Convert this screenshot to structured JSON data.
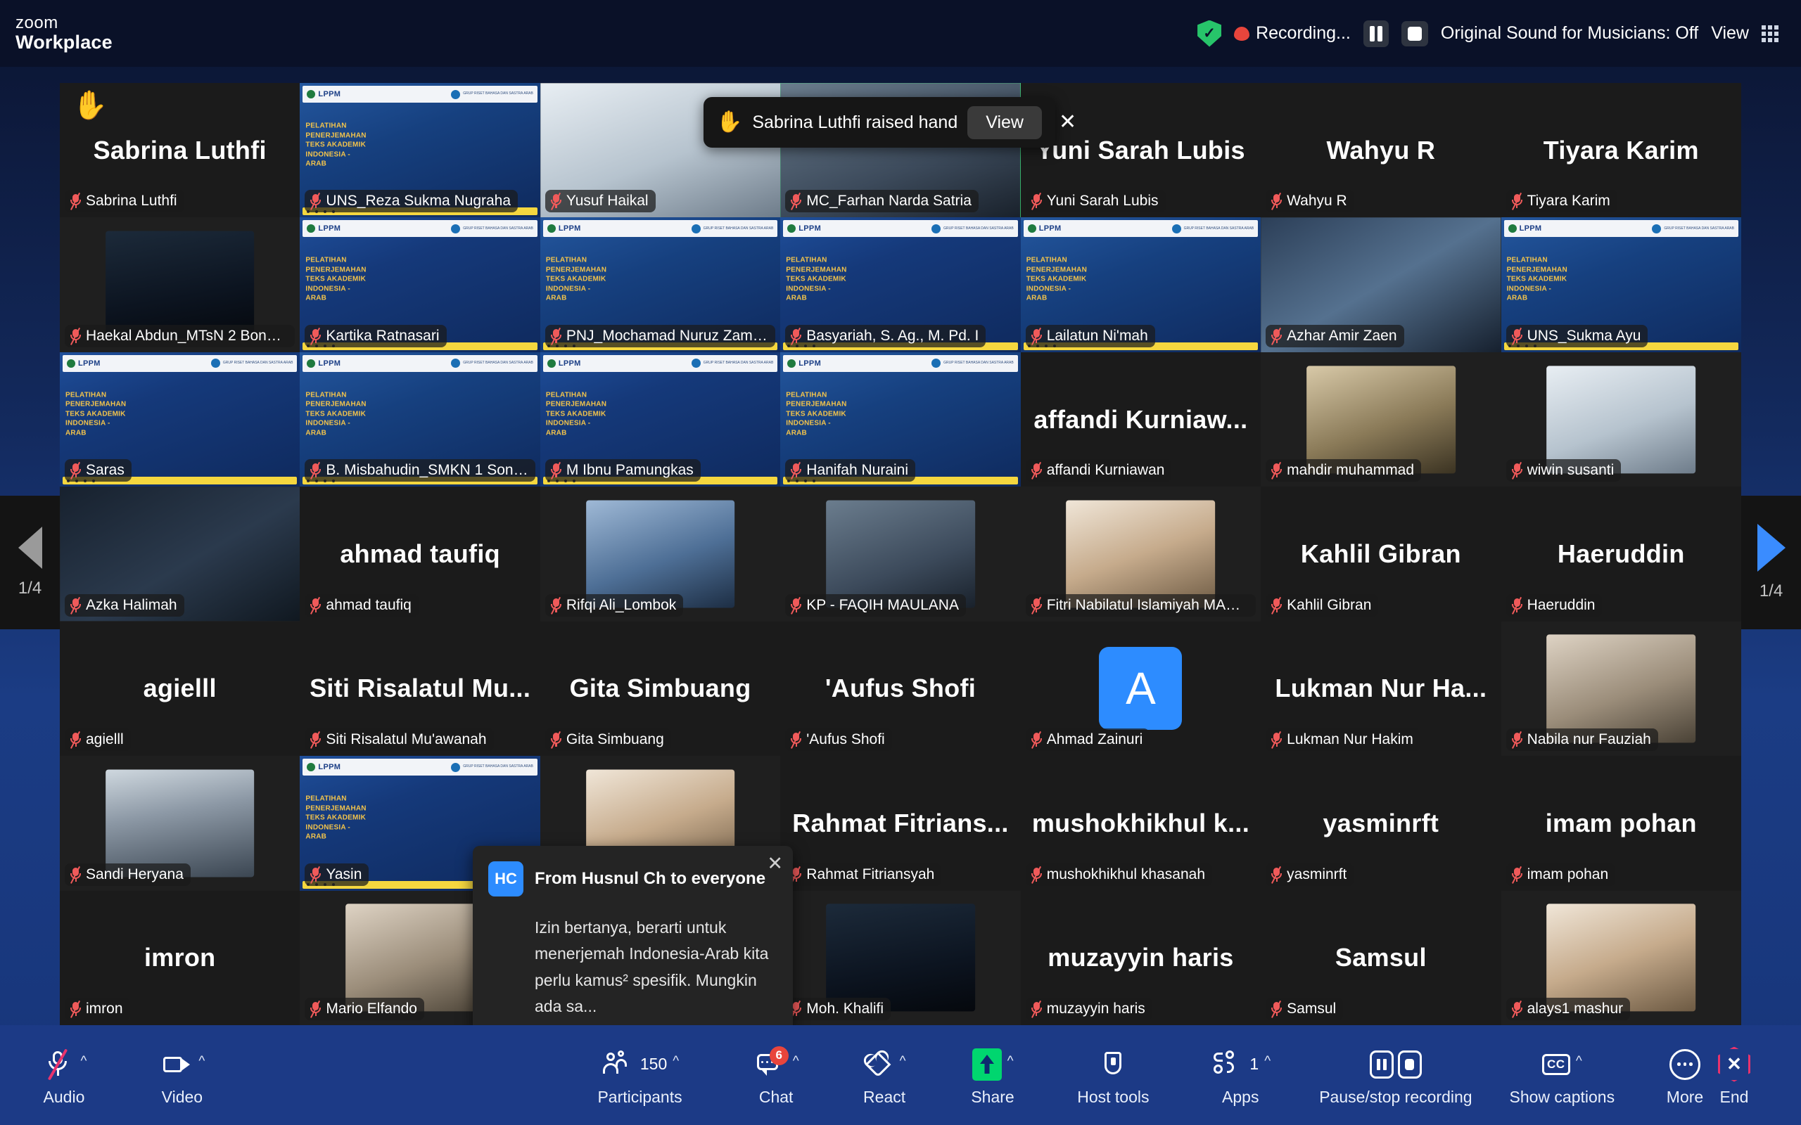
{
  "app": {
    "brand_line1": "zoom",
    "brand_line2": "Workplace"
  },
  "topbar": {
    "encryption_icon": "shield-check-icon",
    "recording_icon": "recording-dot-icon",
    "recording_text": "Recording...",
    "pause_icon": "pause-icon",
    "stop_icon": "stop-icon",
    "original_sound_label": "Original Sound for Musicians: Off",
    "view_label": "View",
    "view_grid_icon": "grid-view-icon"
  },
  "hand_toast": {
    "hand_icon": "raised-hand-icon",
    "message": "Sabrina Luthfi raised hand",
    "view_button": "View",
    "close_icon": "close-icon"
  },
  "chat_toast": {
    "avatar_initials": "HC",
    "header": "From Husnul Ch to everyone",
    "message": "Izin bertanya, berarti untuk menerjemah Indonesia-Arab kita perlu kamus² spesifik. Mungkin ada sa...",
    "close_icon": "close-icon"
  },
  "pagination": {
    "prev_icon": "chevron-left-icon",
    "next_icon": "chevron-right-icon",
    "prev_count": "1/4",
    "next_count": "1/4"
  },
  "slide": {
    "brand": "LPPM",
    "title_lines": "PELATIHAN\nPENERJEMAHAN\nTEKS AKADEMIK\nINDONESIA -\nARAB",
    "header_right": "GRUP RISET BAHASA DAN SASTRA ARAB\nFAKULTAS ILMU BUDAYA\nUNIVERSITAS SEBELAS MARET"
  },
  "participants": [
    {
      "label": "Sabrina Luthfi",
      "big": "Sabrina Luthfi",
      "kind": "name",
      "muted": true,
      "hand": true,
      "speaking": false
    },
    {
      "label": "UNS_Reza Sukma Nugraha",
      "big": "",
      "kind": "slide",
      "muted": true,
      "hand": false,
      "speaking": false
    },
    {
      "label": "Yusuf Haikal",
      "big": "",
      "kind": "video",
      "muted": true,
      "hand": false,
      "speaking": false,
      "photo": "ph-e"
    },
    {
      "label": "MC_Farhan Narda Satria",
      "big": "",
      "kind": "video",
      "muted": true,
      "hand": false,
      "speaking": true,
      "photo": "ph-c"
    },
    {
      "label": "Yuni Sarah Lubis",
      "big": "Yuni Sarah Lubis",
      "kind": "name",
      "muted": true,
      "hand": false,
      "speaking": false
    },
    {
      "label": "Wahyu R",
      "big": "Wahyu R",
      "kind": "name",
      "muted": true,
      "hand": false,
      "speaking": false
    },
    {
      "label": "Tiyara Karim",
      "big": "Tiyara Karim",
      "kind": "name",
      "muted": true,
      "hand": false,
      "speaking": false
    },
    {
      "label": "Haekal Abdun_MTsN 2 Bondo...",
      "big": "",
      "kind": "photo",
      "muted": true,
      "hand": false,
      "speaking": false,
      "photo": "ph-f"
    },
    {
      "label": "Kartika Ratnasari",
      "big": "",
      "kind": "slide",
      "muted": true,
      "hand": false,
      "speaking": false
    },
    {
      "label": "PNJ_Mochamad Nuruz Zaman",
      "big": "",
      "kind": "slide",
      "muted": true,
      "hand": false,
      "speaking": false
    },
    {
      "label": "Basyariah, S. Ag., M. Pd. I",
      "big": "",
      "kind": "slide",
      "muted": true,
      "hand": false,
      "speaking": false
    },
    {
      "label": "Lailatun Ni'mah",
      "big": "",
      "kind": "slide",
      "muted": true,
      "hand": false,
      "speaking": false
    },
    {
      "label": "Azhar Amir Zaen",
      "big": "",
      "kind": "video",
      "muted": true,
      "hand": false,
      "speaking": false,
      "photo": "ph-h"
    },
    {
      "label": "UNS_Sukma Ayu",
      "big": "",
      "kind": "slide",
      "muted": true,
      "hand": false,
      "speaking": false
    },
    {
      "label": "Saras",
      "big": "",
      "kind": "slide",
      "muted": true,
      "hand": false,
      "speaking": false
    },
    {
      "label": "B. Misbahudin_SMKN 1 Song...",
      "big": "",
      "kind": "slide",
      "muted": true,
      "hand": false,
      "speaking": false
    },
    {
      "label": "M Ibnu Pamungkas",
      "big": "",
      "kind": "slide",
      "muted": true,
      "hand": false,
      "speaking": false
    },
    {
      "label": "Hanifah Nuraini",
      "big": "",
      "kind": "slide",
      "muted": true,
      "hand": false,
      "speaking": false
    },
    {
      "label": "affandi Kurniawan",
      "big": "affandi  Kurniaw...",
      "kind": "name",
      "muted": true,
      "hand": false,
      "speaking": false
    },
    {
      "label": "mahdir muhammad",
      "big": "",
      "kind": "photo",
      "muted": true,
      "hand": false,
      "speaking": false,
      "photo": "ph-d"
    },
    {
      "label": "wiwin susanti",
      "big": "",
      "kind": "photo",
      "muted": true,
      "hand": false,
      "speaking": false,
      "photo": "ph-e"
    },
    {
      "label": "Azka Halimah",
      "big": "",
      "kind": "video",
      "muted": true,
      "hand": false,
      "speaking": false,
      "photo": "ph-b"
    },
    {
      "label": "ahmad taufiq",
      "big": "ahmad taufiq",
      "kind": "name",
      "muted": true,
      "hand": false,
      "speaking": false
    },
    {
      "label": "Rifqi Ali_Lombok",
      "big": "",
      "kind": "photo",
      "muted": true,
      "hand": false,
      "speaking": false,
      "photo": "ph-j"
    },
    {
      "label": "KP - FAQIH MAULANA",
      "big": "",
      "kind": "photo",
      "muted": true,
      "hand": false,
      "speaking": false,
      "photo": "ph-c"
    },
    {
      "label": "Fitri Nabilatul Islamiyah MAM...",
      "big": "",
      "kind": "photo",
      "muted": true,
      "hand": false,
      "speaking": false,
      "photo": "ph-g"
    },
    {
      "label": "Kahlil Gibran",
      "big": "Kahlil Gibran",
      "kind": "name",
      "muted": true,
      "hand": false,
      "speaking": false
    },
    {
      "label": "Haeruddin",
      "big": "Haeruddin",
      "kind": "name",
      "muted": true,
      "hand": false,
      "speaking": false
    },
    {
      "label": "agielll",
      "big": "agielll",
      "kind": "name",
      "muted": true,
      "hand": false,
      "speaking": false
    },
    {
      "label": "Siti Risalatul Mu'awanah",
      "big": "Siti Risalatul Mu...",
      "kind": "name",
      "muted": true,
      "hand": false,
      "speaking": false
    },
    {
      "label": "Gita Simbuang",
      "big": "Gita Simbuang",
      "kind": "name",
      "muted": true,
      "hand": false,
      "speaking": false
    },
    {
      "label": "'Aufus Shofi",
      "big": "'Aufus Shofi",
      "kind": "name",
      "muted": true,
      "hand": false,
      "speaking": false
    },
    {
      "label": "Ahmad Zainuri",
      "big": "",
      "kind": "avatar",
      "initial": "A",
      "muted": true,
      "hand": false,
      "speaking": false
    },
    {
      "label": "Lukman Nur Hakim",
      "big": "Lukman  Nur  Ha...",
      "kind": "name",
      "muted": true,
      "hand": false,
      "speaking": false
    },
    {
      "label": "Nabila nur Fauziah",
      "big": "",
      "kind": "photo",
      "muted": true,
      "hand": false,
      "speaking": false,
      "photo": "ph-i"
    },
    {
      "label": "Sandi Heryana",
      "big": "",
      "kind": "photo",
      "muted": true,
      "hand": false,
      "speaking": false,
      "photo": "ph-a"
    },
    {
      "label": "Yasin",
      "big": "",
      "kind": "slide",
      "muted": true,
      "hand": false,
      "speaking": false
    },
    {
      "label": "",
      "big": "",
      "kind": "photo",
      "muted": false,
      "hand": false,
      "speaking": false,
      "photo": "ph-g"
    },
    {
      "label": "Rahmat Fitriansyah",
      "big": "Rahmat  Fitrians...",
      "kind": "name",
      "muted": true,
      "hand": false,
      "speaking": false
    },
    {
      "label": "mushokhikhul khasanah",
      "big": "mushokhikhul  k...",
      "kind": "name",
      "muted": true,
      "hand": false,
      "speaking": false
    },
    {
      "label": "yasminrft",
      "big": "yasminrft",
      "kind": "name",
      "muted": true,
      "hand": false,
      "speaking": false
    },
    {
      "label": "imam pohan",
      "big": "imam pohan",
      "kind": "name",
      "muted": true,
      "hand": false,
      "speaking": false
    },
    {
      "label": "imron",
      "big": "imron",
      "kind": "name",
      "muted": true,
      "hand": false,
      "speaking": false
    },
    {
      "label": "Mario Elfando",
      "big": "",
      "kind": "photo",
      "muted": true,
      "hand": false,
      "speaking": false,
      "photo": "ph-i"
    },
    {
      "label": "",
      "big": "",
      "kind": "blank",
      "muted": false,
      "hand": false,
      "speaking": false
    },
    {
      "label": "Moh. Khalifi",
      "big": "",
      "kind": "photo",
      "muted": true,
      "hand": false,
      "speaking": false,
      "photo": "ph-f"
    },
    {
      "label": "muzayyin haris",
      "big": "muzayyin haris",
      "kind": "name",
      "muted": true,
      "hand": false,
      "speaking": false
    },
    {
      "label": "Samsul",
      "big": "Samsul",
      "kind": "name",
      "muted": true,
      "hand": false,
      "speaking": false
    },
    {
      "label": "alays1 mashur",
      "big": "",
      "kind": "photo",
      "muted": true,
      "hand": false,
      "speaking": false,
      "photo": "ph-g"
    }
  ],
  "toolbar": {
    "audio": {
      "label": "Audio",
      "icon": "microphone-muted-icon",
      "caret": true
    },
    "video": {
      "label": "Video",
      "icon": "camera-icon",
      "caret": true
    },
    "participants": {
      "label": "Participants",
      "icon": "participants-icon",
      "count": "150",
      "caret": true
    },
    "chat": {
      "label": "Chat",
      "icon": "chat-bubble-icon",
      "badge": "6",
      "caret": true
    },
    "react": {
      "label": "React",
      "icon": "heart-icon",
      "caret": true
    },
    "share": {
      "label": "Share",
      "icon": "share-screen-icon",
      "caret": true
    },
    "host_tools": {
      "label": "Host tools",
      "icon": "shield-icon",
      "caret": false
    },
    "apps": {
      "label": "Apps",
      "icon": "apps-icon",
      "count": "1",
      "caret": true
    },
    "recording": {
      "label": "Pause/stop recording",
      "pause_icon": "pause-icon",
      "stop_icon": "stop-icon"
    },
    "captions": {
      "label": "Show captions",
      "icon": "closed-captions-icon",
      "caret": true
    },
    "more": {
      "label": "More",
      "icon": "ellipsis-icon",
      "caret": false
    },
    "end": {
      "label": "End",
      "icon": "end-call-icon"
    }
  }
}
